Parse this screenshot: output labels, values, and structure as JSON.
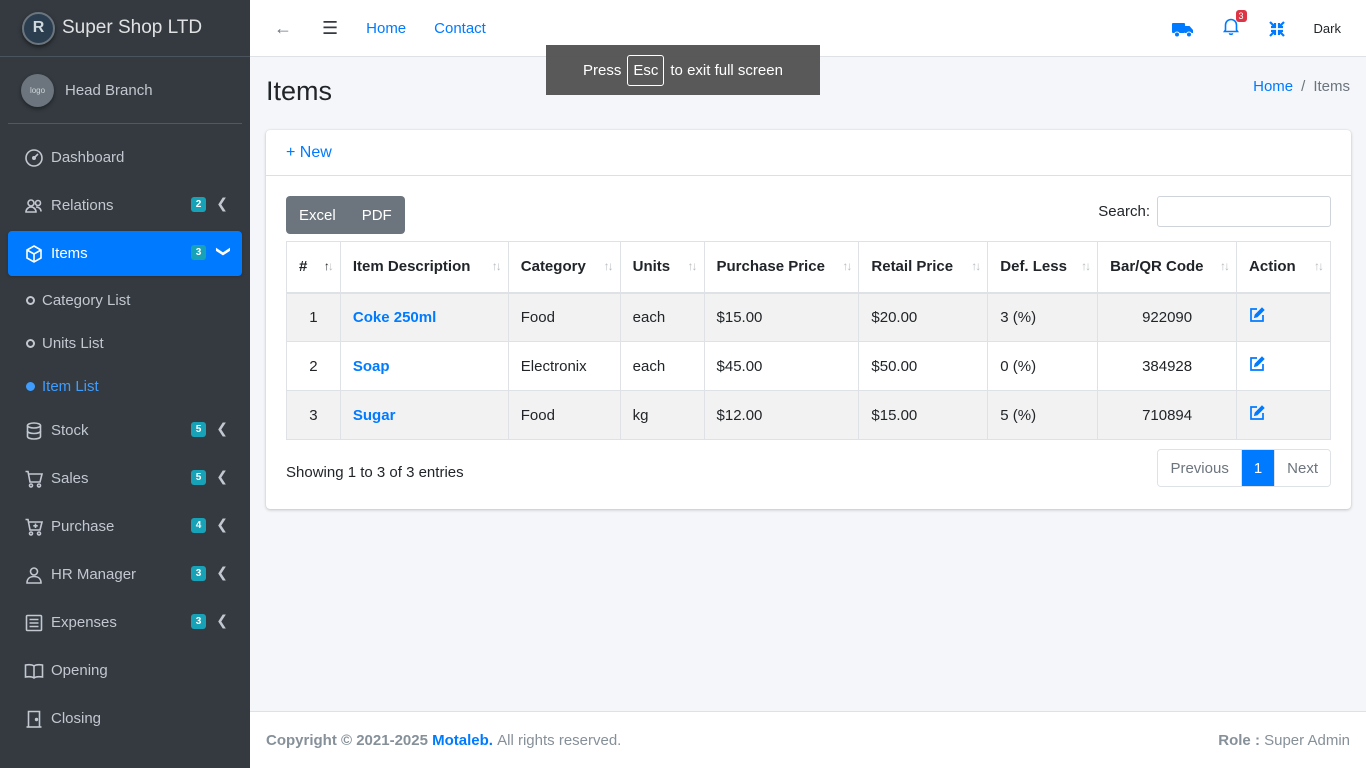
{
  "brand": {
    "name": "Super Shop LTD",
    "logo_text": "R"
  },
  "user": {
    "name": "Head Branch",
    "avatar_text": "logo"
  },
  "sidebar": {
    "items": [
      {
        "label": "Dashboard"
      },
      {
        "label": "Relations",
        "badge": "2"
      },
      {
        "label": "Items",
        "badge": "3"
      },
      {
        "label": "Stock",
        "badge": "5"
      },
      {
        "label": "Sales",
        "badge": "5"
      },
      {
        "label": "Purchase",
        "badge": "4"
      },
      {
        "label": "HR Manager",
        "badge": "3"
      },
      {
        "label": "Expenses",
        "badge": "3"
      },
      {
        "label": "Opening"
      },
      {
        "label": "Closing"
      }
    ],
    "sub_items": [
      {
        "label": "Category List"
      },
      {
        "label": "Units List"
      },
      {
        "label": "Item List"
      }
    ]
  },
  "topbar": {
    "home": "Home",
    "contact": "Contact",
    "notif_count": "3",
    "theme_label": "Dark"
  },
  "toast": {
    "prefix": "Press",
    "key": "Esc",
    "suffix": "to exit full screen"
  },
  "page": {
    "title": "Items",
    "breadcrumb": {
      "home": "Home",
      "sep": "/",
      "current": "Items"
    }
  },
  "card": {
    "new_label": "+ New",
    "buttons": {
      "excel": "Excel",
      "pdf": "PDF"
    },
    "search_label": "Search:",
    "search_value": ""
  },
  "table": {
    "headers": [
      "#",
      "Item Description",
      "Category",
      "Units",
      "Purchase Price",
      "Retail Price",
      "Def. Less",
      "Bar/QR Code",
      "Action"
    ],
    "rows": [
      {
        "num": "1",
        "desc": "Coke 250ml",
        "category": "Food",
        "units": "each",
        "purchase": "$15.00",
        "retail": "$20.00",
        "less": "3 (%)",
        "code": "922090"
      },
      {
        "num": "2",
        "desc": "Soap",
        "category": "Electronix",
        "units": "each",
        "purchase": "$45.00",
        "retail": "$50.00",
        "less": "0 (%)",
        "code": "384928"
      },
      {
        "num": "3",
        "desc": "Sugar",
        "category": "Food",
        "units": "kg",
        "purchase": "$12.00",
        "retail": "$15.00",
        "less": "5 (%)",
        "code": "710894"
      }
    ]
  },
  "pagination": {
    "info": "Showing 1 to 3 of 3 entries",
    "previous": "Previous",
    "current": "1",
    "next": "Next"
  },
  "footer": {
    "copyright": "Copyright © 2021-2025",
    "company": "Motaleb.",
    "rights": "All rights reserved.",
    "role_label": "Role :",
    "role_value": "Super Admin"
  }
}
